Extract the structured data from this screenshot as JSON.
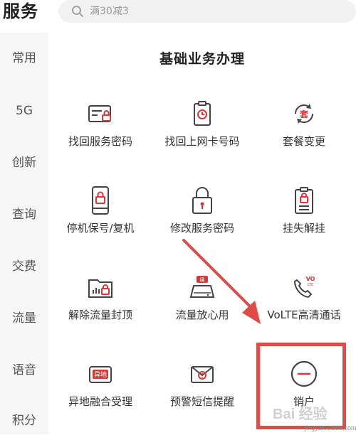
{
  "header": {
    "title": "服务",
    "search_placeholder": "满30减3"
  },
  "sidebar": {
    "items": [
      {
        "label": "常用"
      },
      {
        "label": "5G"
      },
      {
        "label": "创新"
      },
      {
        "label": "查询"
      },
      {
        "label": "交费"
      },
      {
        "label": "流量"
      },
      {
        "label": "语音"
      },
      {
        "label": "积分"
      }
    ]
  },
  "main": {
    "section_title": "基础业务办理",
    "services": [
      {
        "label": "找回服务密码",
        "icon": "password-card-icon"
      },
      {
        "label": "找回上网卡号码",
        "icon": "sim-clock-icon"
      },
      {
        "label": "套餐变更",
        "icon": "package-change-icon"
      },
      {
        "label": "停机保号/复机",
        "icon": "phone-lock-icon"
      },
      {
        "label": "修改服务密码",
        "icon": "padlock-icon"
      },
      {
        "label": "挂失解挂",
        "icon": "clipboard-lock-icon"
      },
      {
        "label": "解除流量封顶",
        "icon": "folder-chart-icon"
      },
      {
        "label": "流量放心用",
        "icon": "data-secure-icon"
      },
      {
        "label": "VoLTE高清通话",
        "icon": "volte-phone-icon"
      },
      {
        "label": "异地融合受理",
        "icon": "remote-merge-icon"
      },
      {
        "label": "预警短信提醒",
        "icon": "alert-envelope-icon"
      },
      {
        "label": "销户",
        "icon": "minus-circle-icon"
      }
    ]
  },
  "watermark": {
    "text": "Bai 经验",
    "subtext": "jingyan.baidu.com"
  },
  "colors": {
    "accent": "#d9383a",
    "highlight": "#e04a47"
  }
}
